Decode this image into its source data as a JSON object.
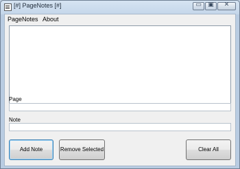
{
  "window": {
    "title": "[#] PageNotes [#]"
  },
  "caption": {
    "minimize": "▭",
    "maximize": "▣",
    "close": "✕"
  },
  "menu": {
    "items": [
      "PageNotes",
      "About"
    ]
  },
  "form": {
    "page_label": "Page",
    "page_value": "",
    "note_label": "Note",
    "note_value": ""
  },
  "buttons": {
    "add_note": "Add Note",
    "remove_selected": "Remove Selected",
    "clear_all": "Clear All"
  },
  "colors": {
    "titlebar": "#c4d6ea",
    "client": "#f0f0f0",
    "default_button_border": "#3c7fb1"
  }
}
